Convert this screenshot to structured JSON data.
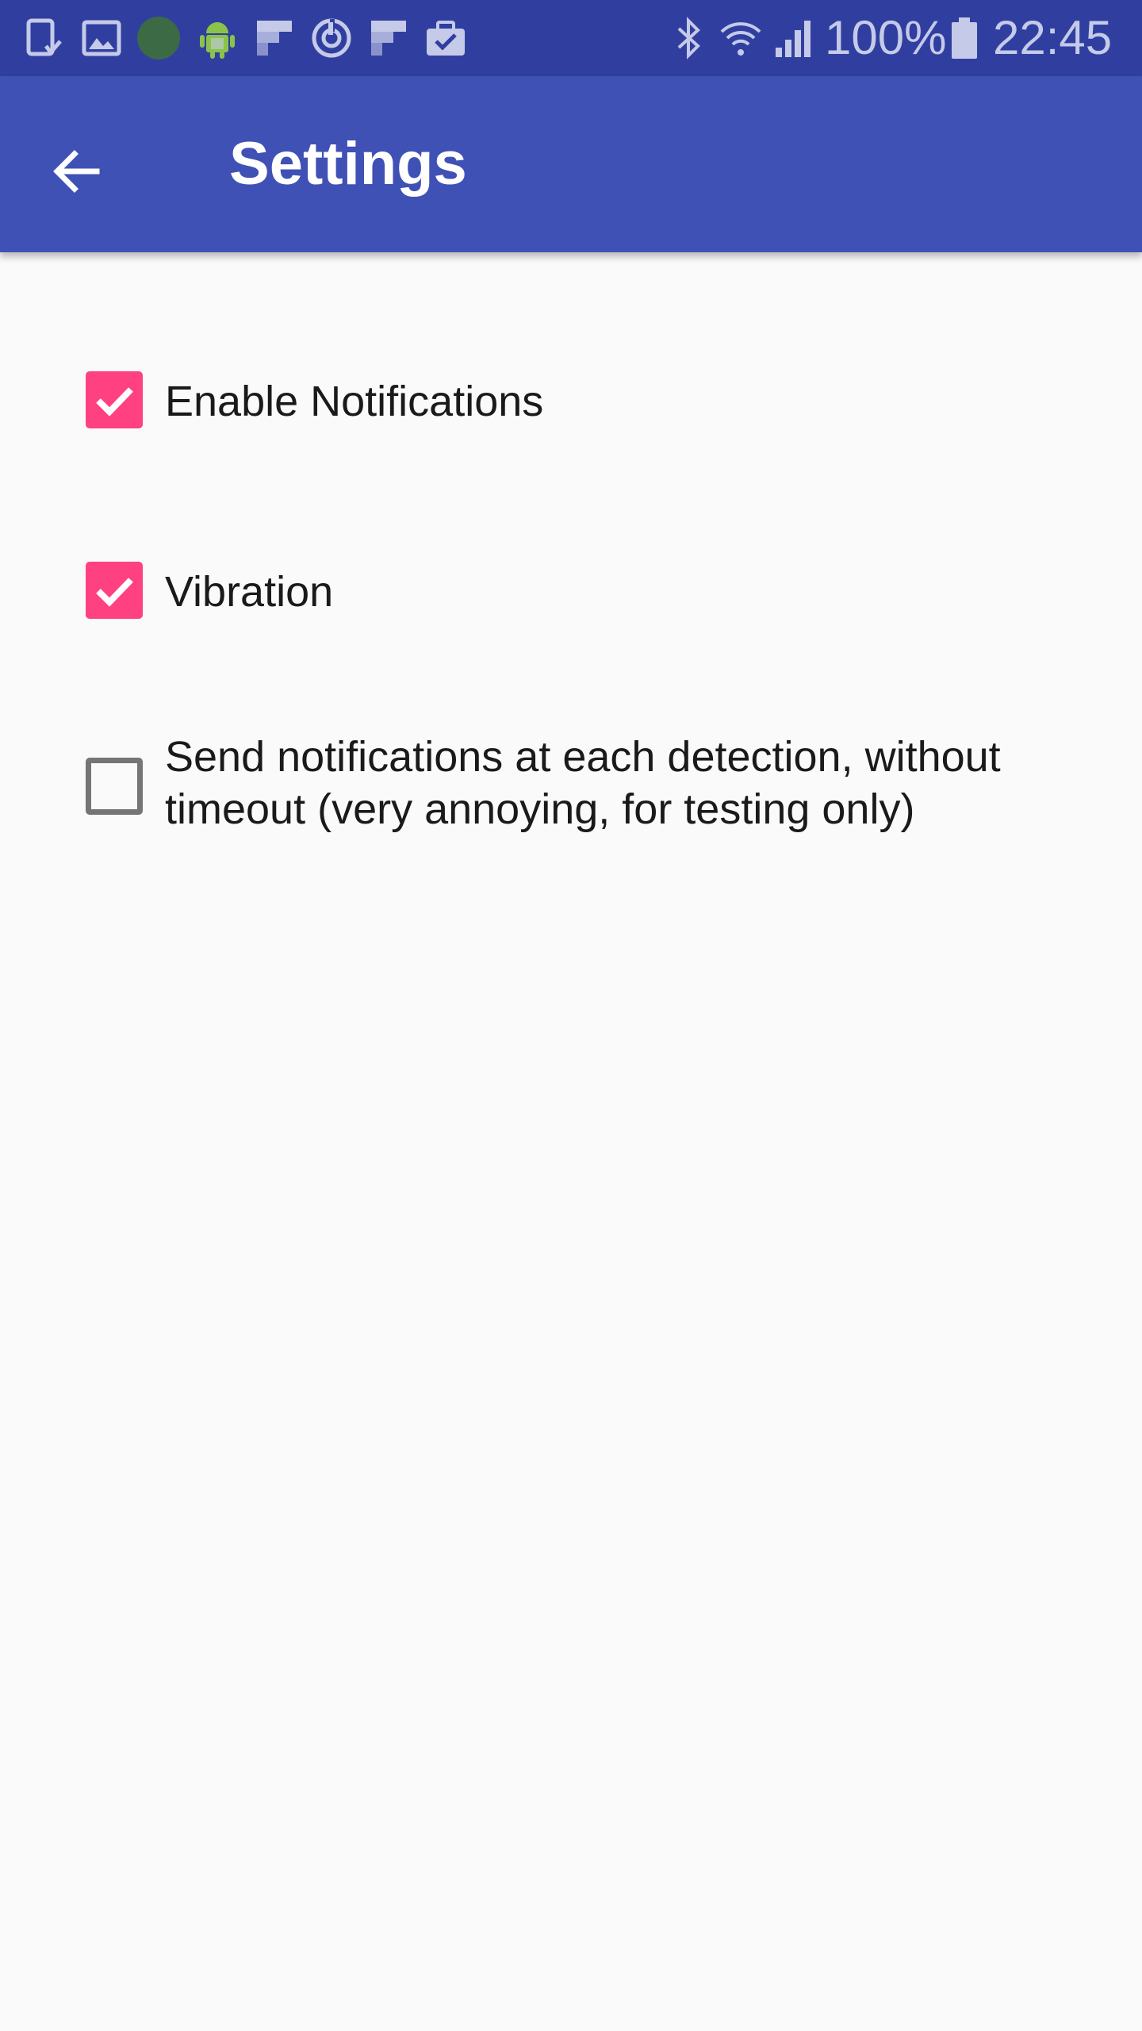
{
  "status_bar": {
    "left_icons": [
      "tablet-download-icon",
      "image-icon",
      "green-dot-icon",
      "android-icon",
      "flipboard-icon",
      "sync-icon",
      "flipboard-icon",
      "briefcase-check-icon"
    ],
    "right_icons": [
      "bluetooth-icon",
      "wifi-icon",
      "signal-icon",
      "battery-icon"
    ],
    "battery_percent": "100%",
    "time": "22:45"
  },
  "app_bar": {
    "title": "Settings",
    "back_icon": "arrow-back-icon"
  },
  "preferences": [
    {
      "label": "Enable Notifications",
      "checked": true
    },
    {
      "label": "Vibration",
      "checked": true
    },
    {
      "label": "Send notifications at each detection, without timeout (very annoying, for testing only)",
      "checked": false
    }
  ],
  "colors": {
    "status_bar": "#303f9f",
    "app_bar": "#3f51b5",
    "accent": "#ff4081",
    "background": "#fafafa"
  }
}
